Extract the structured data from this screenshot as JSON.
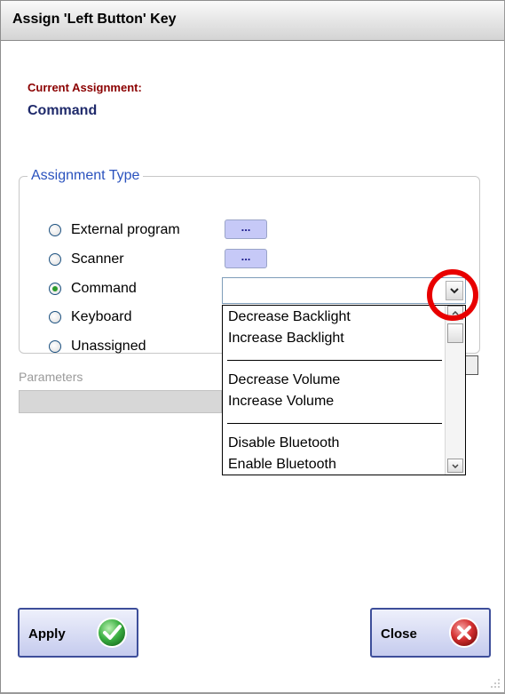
{
  "window": {
    "title": "Assign 'Left Button' Key"
  },
  "current_assignment": {
    "label": "Current Assignment:",
    "value": "Command"
  },
  "assignment_type": {
    "legend": "Assignment Type",
    "options": [
      {
        "label": "External program",
        "checked": false
      },
      {
        "label": "Scanner",
        "checked": false
      },
      {
        "label": "Command",
        "checked": true
      },
      {
        "label": "Keyboard",
        "checked": false
      },
      {
        "label": "Unassigned",
        "checked": false
      }
    ],
    "browse_label": "..."
  },
  "command_combo": {
    "value": "",
    "dropdown_items": [
      "Decrease Backlight",
      "Increase Backlight",
      "Decrease Volume",
      "Increase Volume",
      "Disable Bluetooth",
      "Enable Bluetooth"
    ]
  },
  "parameters": {
    "label": "Parameters",
    "value": ""
  },
  "buttons": {
    "apply": "Apply",
    "close": "Close"
  },
  "colors": {
    "current_label": "#8b0000",
    "current_value": "#1f2a6b",
    "legend": "#2a52be",
    "highlight": "#e80000",
    "apply_icon": "#3cb043",
    "close_icon": "#d32f2f"
  },
  "icons": {
    "apply": "checkmark-circle-icon",
    "close": "x-circle-icon",
    "combo_arrow": "chevron-down-icon"
  }
}
